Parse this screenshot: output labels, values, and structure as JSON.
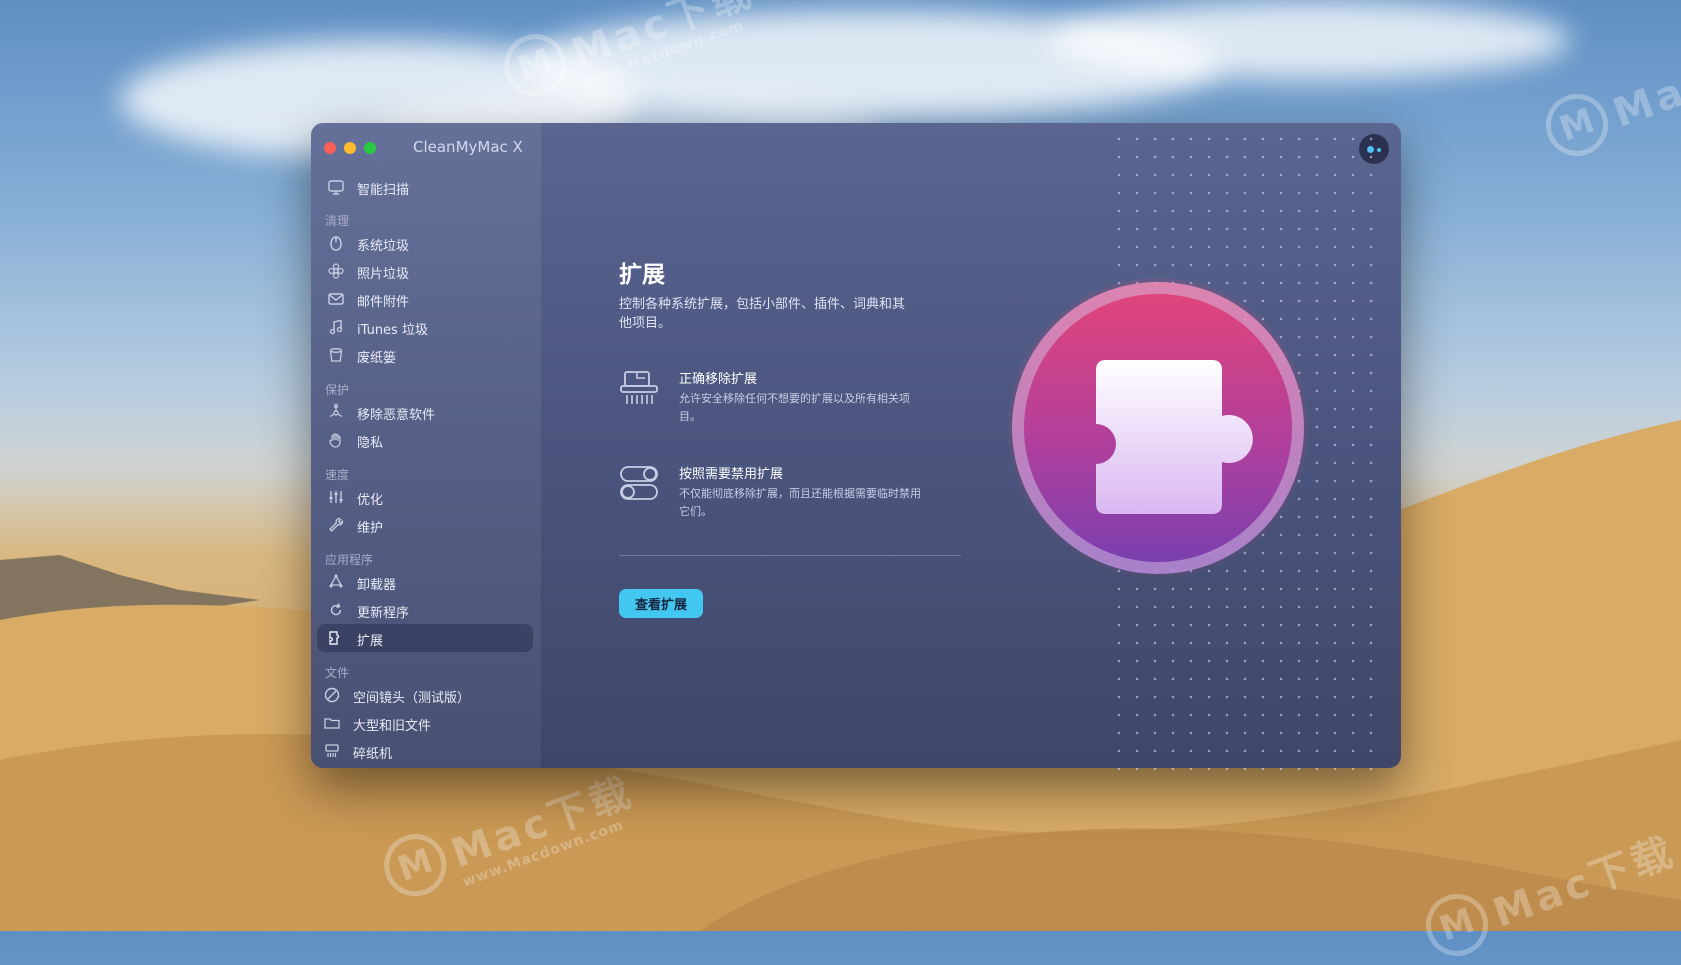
{
  "window": {
    "title": "CleanMyMac X"
  },
  "sidebar": {
    "smart_scan": {
      "label": "智能扫描",
      "icon": "monitor-scan-icon"
    },
    "sections": {
      "cleanup": "清理",
      "protection": "保护",
      "speed": "速度",
      "applications": "应用程序",
      "files": "文件"
    },
    "items": {
      "system_junk": {
        "label": "系统垃圾",
        "icon": "system-junk-icon"
      },
      "photo_junk": {
        "label": "照片垃圾",
        "icon": "flower-icon"
      },
      "mail_attachments": {
        "label": "邮件附件",
        "icon": "envelope-icon"
      },
      "itunes_junk": {
        "label": "iTunes 垃圾",
        "icon": "music-note-icon"
      },
      "trash_bins": {
        "label": "废纸篓",
        "icon": "trash-bin-icon"
      },
      "malware_removal": {
        "label": "移除恶意软件",
        "icon": "biohazard-icon"
      },
      "privacy": {
        "label": "隐私",
        "icon": "hand-icon"
      },
      "optimization": {
        "label": "优化",
        "icon": "sliders-icon"
      },
      "maintenance": {
        "label": "维护",
        "icon": "wrench-icon"
      },
      "uninstaller": {
        "label": "卸载器",
        "icon": "uninstaller-icon"
      },
      "updater": {
        "label": "更新程序",
        "icon": "update-arrow-icon"
      },
      "extensions": {
        "label": "扩展",
        "icon": "extensions-icon"
      },
      "space_lens": {
        "label": "空间镜头（测试版）",
        "icon": "space-lens-icon"
      },
      "large_old_files": {
        "label": "大型和旧文件",
        "icon": "folder-icon"
      },
      "shredder": {
        "label": "碎纸机",
        "icon": "shredder-icon"
      }
    }
  },
  "main": {
    "title": "扩展",
    "description": "控制各种系统扩展，包括小部件、插件、词典和其他项目。",
    "features": [
      {
        "title": "正确移除扩展",
        "description": "允许安全移除任何不想要的扩展以及所有相关项目。",
        "icon": "shredder-icon"
      },
      {
        "title": "按照需要禁用扩展",
        "description": "不仅能彻底移除扩展，而且还能根据需要临时禁用它们。",
        "icon": "toggle-switches-icon"
      }
    ],
    "button_label": "查看扩展",
    "hero_icon": "puzzle-piece-icon"
  },
  "watermark": {
    "brand": "Mac下载",
    "site": "www.Macdown.com"
  },
  "colors": {
    "accent": "#42c8f0",
    "hero_pink": "#e0457b",
    "hero_purple": "#8a3fb0"
  }
}
